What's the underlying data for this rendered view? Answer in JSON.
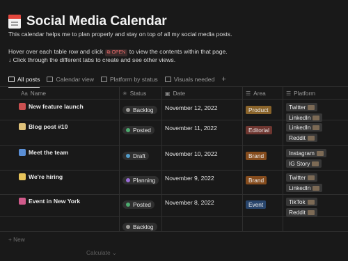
{
  "page": {
    "title": "Social Media Calendar",
    "desc1": "This calendar helps me to plan properly and stay on top of all my social media posts.",
    "desc2_before": "Hover over each table row and click",
    "desc2_chip": "OPEN",
    "desc2_after": "to view the contents within that page.",
    "desc3": "↓ Click through the different tabs to create and see other views."
  },
  "tabs": [
    {
      "label": "All posts",
      "active": true
    },
    {
      "label": "Calendar view"
    },
    {
      "label": "Platform by status"
    },
    {
      "label": "Visuals needed"
    }
  ],
  "columns": {
    "name": "Name",
    "status": "Status",
    "date": "Date",
    "area": "Area",
    "platform": "Platform"
  },
  "rows": [
    {
      "name": "New feature launch",
      "icon": "rocket-icon",
      "status": "Backlog",
      "date": "November 12, 2022",
      "area": "Product",
      "platforms": [
        "Twitter",
        "LinkedIn"
      ]
    },
    {
      "name": "Blog post #10",
      "icon": "memo-icon",
      "status": "Posted",
      "date": "November 11, 2022",
      "area": "Editorial",
      "platforms": [
        "LinkedIn",
        "Reddit"
      ]
    },
    {
      "name": "Meet the team",
      "icon": "people-icon",
      "status": "Draft",
      "date": "November 10, 2022",
      "area": "Brand",
      "platforms": [
        "Instagram",
        "IG Story"
      ]
    },
    {
      "name": "We're hiring",
      "icon": "sparkle-icon",
      "status": "Planning",
      "date": "November 9, 2022",
      "area": "Brand",
      "platforms": [
        "Twitter",
        "LinkedIn"
      ]
    },
    {
      "name": "Event in New York",
      "icon": "ticket-icon",
      "status": "Posted",
      "date": "November 8, 2022",
      "area": "Event",
      "platforms": [
        "TikTok",
        "Reddit"
      ]
    },
    {
      "name": "",
      "status": "Backlog",
      "date": "",
      "area": "",
      "platforms": []
    }
  ],
  "footer": {
    "new_label": "+ New",
    "calculate_label": "Calculate ⌄"
  },
  "colors": {
    "Backlog": "#9b9a97",
    "Posted": "#4dab6f",
    "Draft": "#529cca",
    "Planning": "#9a6dd7",
    "Product": "#89632a",
    "Editorial": "#6e3630",
    "Brand": "#854c1d",
    "Event": "#28456c"
  }
}
